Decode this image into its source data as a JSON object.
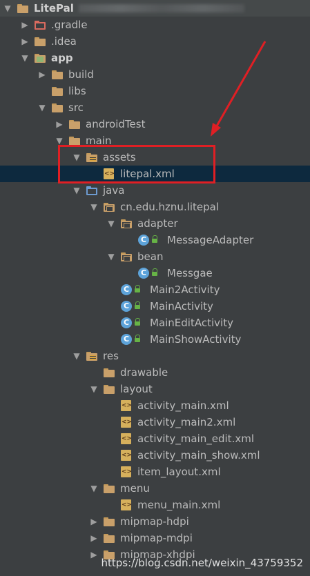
{
  "tree": [
    {
      "label": "LitePal",
      "depth": 0,
      "arrow": "down",
      "icon": "folder-icon",
      "bold": true,
      "top": true
    },
    {
      "label": ".gradle",
      "depth": 1,
      "arrow": "right",
      "icon": "folder-red-icon"
    },
    {
      "label": ".idea",
      "depth": 1,
      "arrow": "right",
      "icon": "folder-icon"
    },
    {
      "label": "app",
      "depth": 1,
      "arrow": "down",
      "icon": "folder-app-icon",
      "bold": true
    },
    {
      "label": "build",
      "depth": 2,
      "arrow": "right",
      "icon": "folder-icon"
    },
    {
      "label": "libs",
      "depth": 2,
      "arrow": "",
      "icon": "folder-icon"
    },
    {
      "label": "src",
      "depth": 2,
      "arrow": "down",
      "icon": "folder-icon"
    },
    {
      "label": "androidTest",
      "depth": 3,
      "arrow": "right",
      "icon": "folder-icon"
    },
    {
      "label": "main",
      "depth": 3,
      "arrow": "down",
      "icon": "folder-icon"
    },
    {
      "label": "assets",
      "depth": 4,
      "arrow": "down",
      "icon": "folder-res-icon"
    },
    {
      "label": "litepal.xml",
      "depth": 5,
      "arrow": "",
      "icon": "xml-file-icon",
      "selected": true
    },
    {
      "label": "java",
      "depth": 4,
      "arrow": "down",
      "icon": "folder-blue-icon"
    },
    {
      "label": "cn.edu.hznu.litepal",
      "depth": 5,
      "arrow": "down",
      "icon": "folder-package-icon"
    },
    {
      "label": "adapter",
      "depth": 6,
      "arrow": "down",
      "icon": "folder-package-icon"
    },
    {
      "label": "MessageAdapter",
      "depth": 7,
      "arrow": "",
      "icon": "class-icon"
    },
    {
      "label": "bean",
      "depth": 6,
      "arrow": "down",
      "icon": "folder-package-icon"
    },
    {
      "label": "Messgae",
      "depth": 7,
      "arrow": "",
      "icon": "class-icon"
    },
    {
      "label": "Main2Activity",
      "depth": 6,
      "arrow": "",
      "icon": "class-icon"
    },
    {
      "label": "MainActivity",
      "depth": 6,
      "arrow": "",
      "icon": "class-icon"
    },
    {
      "label": "MainEditActivity",
      "depth": 6,
      "arrow": "",
      "icon": "class-icon"
    },
    {
      "label": "MainShowActivity",
      "depth": 6,
      "arrow": "",
      "icon": "class-icon"
    },
    {
      "label": "res",
      "depth": 4,
      "arrow": "down",
      "icon": "folder-res-icon"
    },
    {
      "label": "drawable",
      "depth": 5,
      "arrow": "",
      "icon": "folder-icon"
    },
    {
      "label": "layout",
      "depth": 5,
      "arrow": "down",
      "icon": "folder-icon"
    },
    {
      "label": "activity_main.xml",
      "depth": 6,
      "arrow": "",
      "icon": "xml-file-icon"
    },
    {
      "label": "activity_main2.xml",
      "depth": 6,
      "arrow": "",
      "icon": "xml-file-icon"
    },
    {
      "label": "activity_main_edit.xml",
      "depth": 6,
      "arrow": "",
      "icon": "xml-file-icon"
    },
    {
      "label": "activity_main_show.xml",
      "depth": 6,
      "arrow": "",
      "icon": "xml-file-icon"
    },
    {
      "label": "item_layout.xml",
      "depth": 6,
      "arrow": "",
      "icon": "xml-file-icon"
    },
    {
      "label": "menu",
      "depth": 5,
      "arrow": "down",
      "icon": "folder-icon"
    },
    {
      "label": "menu_main.xml",
      "depth": 6,
      "arrow": "",
      "icon": "xml-file-icon"
    },
    {
      "label": "mipmap-hdpi",
      "depth": 5,
      "arrow": "right",
      "icon": "folder-icon"
    },
    {
      "label": "mipmap-mdpi",
      "depth": 5,
      "arrow": "right",
      "icon": "folder-icon"
    },
    {
      "label": "mipmap-xhdpi",
      "depth": 5,
      "arrow": "right",
      "icon": "folder-icon"
    }
  ],
  "watermark": "https://blog.csdn.net/weixin_43759352",
  "colors": {
    "background": "#3c3f41",
    "selected_row": "#0d293e",
    "highlight": "#e01f24",
    "class_icon": "#5da3d9",
    "lock_icon": "#67b346"
  }
}
